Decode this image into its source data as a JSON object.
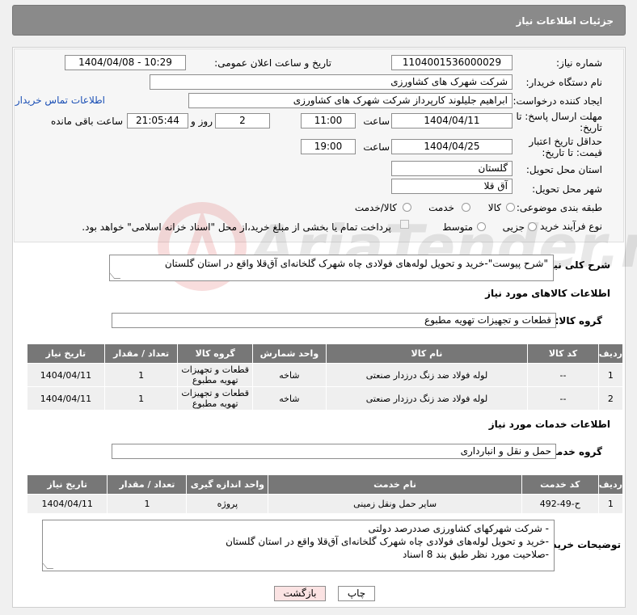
{
  "header": {
    "title": "جزئیات اطلاعات نیاز"
  },
  "need": {
    "number_label": "شماره نیاز:",
    "number": "1104001536000029",
    "announce_label": "تاریخ و ساعت اعلان عمومی:",
    "announce_value": "1404/04/08 - 10:29",
    "buyer_label": "نام دستگاه خریدار:",
    "buyer": "شرکت شهرک های کشاورزی",
    "creator_label": "ایجاد کننده درخواست:",
    "creator": "ابراهیم جلیلوند کارپرداز شرکت شهرک های کشاورزی",
    "contact_link": "اطلاعات تماس خریدار",
    "reply_label": "مهلت ارسال پاسخ: تا تاریخ:",
    "reply_date": "1404/04/11",
    "time_label": "ساعت",
    "reply_time": "11:00",
    "days": "2",
    "day_and_label": "روز و",
    "remaining": "21:05:44",
    "remaining_label": "ساعت باقی مانده",
    "price_label": "حداقل تاریخ اعتبار قیمت: تا تاریخ:",
    "price_date": "1404/04/25",
    "price_time": "19:00",
    "province_label": "استان محل تحویل:",
    "province": "گلستان",
    "city_label": "شهر محل تحویل:",
    "city": "آق قلا",
    "category_label": "طبقه بندی موضوعی:",
    "category_options": [
      "کالا",
      "خدمت",
      "کالا/خدمت"
    ],
    "process_label": "نوع فرآیند خرید :",
    "process_options": [
      "جزیی",
      "متوسط"
    ],
    "payment_note": "پرداخت تمام یا بخشی از مبلغ خرید،از محل \"اسناد خزانه اسلامی\" خواهد بود."
  },
  "summary": {
    "label": "شرح کلی نیاز:",
    "text": "\"شرح پیوست\"-خرید و تحویل لوله‌های فولادی چاه شهرک گلخانه‌ای آق‌قلا واقع در استان گلستان"
  },
  "goods": {
    "section_title": "اطلاعات کالاهای مورد نیاز",
    "group_label": "گروه کالا:",
    "group": "قطعات و تجهیزات تهویه مطبوع",
    "headers": [
      "ردیف",
      "کد کالا",
      "نام کالا",
      "واحد شمارش",
      "گروه کالا",
      "تعداد / مقدار",
      "تاریخ نیاز"
    ],
    "rows": [
      [
        "1",
        "--",
        "لوله فولاد ضد زنگ درزدار صنعتی",
        "شاخه",
        "قطعات و تجهیزات تهویه مطبوع",
        "1",
        "1404/04/11"
      ],
      [
        "2",
        "--",
        "لوله فولاد ضد زنگ درزدار صنعتی",
        "شاخه",
        "قطعات و تجهیزات تهویه مطبوع",
        "1",
        "1404/04/11"
      ]
    ]
  },
  "services": {
    "section_title": "اطلاعات خدمات مورد نیاز",
    "group_label": "گروه خدمت:",
    "group": "حمل و نقل و انبارداری",
    "headers": [
      "ردیف",
      "کد خدمت",
      "نام خدمت",
      "واحد اندازه گیری",
      "تعداد / مقدار",
      "تاریخ نیاز"
    ],
    "rows": [
      [
        "1",
        "ح-49-492",
        "سایر حمل ونقل زمینی",
        "پروژه",
        "1",
        "1404/04/11"
      ]
    ]
  },
  "buyer_notes": {
    "label": "توضیحات خریدار:",
    "lines": [
      "- شرکت شهرکهای کشاورزی صددرصد دولتی",
      "-خرید و تحویل لوله‌های فولادی چاه شهرک گلخانه‌ای آق‌قلا واقع در استان گلستان",
      "-صلاحیت مورد نظر طبق بند 8 اسناد"
    ]
  },
  "buttons": {
    "print": "چاپ",
    "back": "بازگشت"
  },
  "watermark": {
    "text": "AriaTender.neT"
  },
  "colors": {
    "header_bg": "#8a8a8a",
    "table_header": "#777777",
    "link": "#1a4fb5",
    "back_button": "#fbe3e3"
  }
}
